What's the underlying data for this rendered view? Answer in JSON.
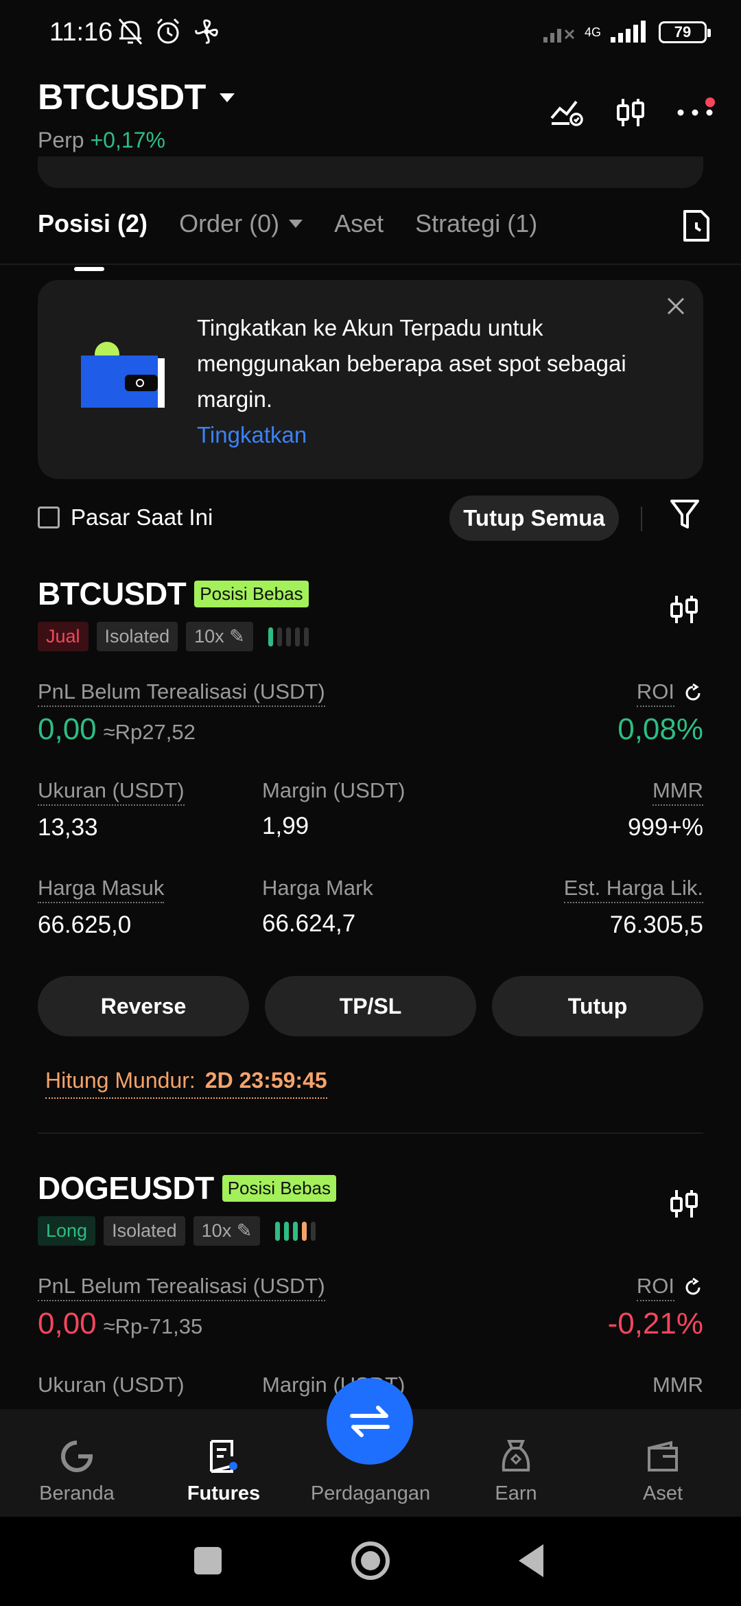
{
  "status_bar": {
    "time": "11:16",
    "network": "4G",
    "battery": "79"
  },
  "header": {
    "pair": "BTCUSDT",
    "type": "Perp",
    "change": "+0,17%"
  },
  "tabs": [
    {
      "label": "Posisi (2)"
    },
    {
      "label": "Order (0)"
    },
    {
      "label": "Aset"
    },
    {
      "label": "Strategi (1)"
    }
  ],
  "banner": {
    "text": "Tingkatkan ke Akun Terpadu untuk menggunakan beberapa aset spot sebagai margin.",
    "link": "Tingkatkan"
  },
  "filter": {
    "checkbox_label": "Pasar Saat Ini",
    "close_all": "Tutup Semua"
  },
  "positions": [
    {
      "pair": "BTCUSDT",
      "badge": "Posisi Bebas",
      "side": "Jual",
      "margin_mode": "Isolated",
      "leverage": "10x",
      "adl_level": 1,
      "pnl_label": "PnL Belum Terealisasi (USDT)",
      "pnl": "0,00",
      "pnl_idr": "≈Rp27,52",
      "roi_label": "ROI",
      "roi": "0,08%",
      "size_label": "Ukuran (USDT)",
      "size": "13,33",
      "margin_label": "Margin (USDT)",
      "margin": "1,99",
      "mmr_label": "MMR",
      "mmr": "999+%",
      "entry_label": "Harga Masuk",
      "entry": "66.625,0",
      "mark_label": "Harga Mark",
      "mark": "66.624,7",
      "liq_label": "Est. Harga Lik.",
      "liq": "76.305,5",
      "buttons": [
        "Reverse",
        "TP/SL",
        "Tutup"
      ],
      "countdown_label": "Hitung Mundur:",
      "countdown": "2D 23:59:45"
    },
    {
      "pair": "DOGEUSDT",
      "badge": "Posisi Bebas",
      "side": "Long",
      "margin_mode": "Isolated",
      "leverage": "10x",
      "adl_level": 4,
      "pnl_label": "PnL Belum Terealisasi (USDT)",
      "pnl": "0,00",
      "pnl_idr": "≈Rp-71,35",
      "roi_label": "ROI",
      "roi": "-0,21%",
      "size_label": "Ukuran (USDT)",
      "margin_label": "Margin (USDT)",
      "mmr_label": "MMR"
    }
  ],
  "bottom_nav": [
    {
      "label": "Beranda",
      "icon": "home-icon"
    },
    {
      "label": "Futures",
      "icon": "futures-icon"
    },
    {
      "label": "Perdagangan",
      "icon": "trade-icon"
    },
    {
      "label": "Earn",
      "icon": "earn-icon"
    },
    {
      "label": "Aset",
      "icon": "wallet-icon"
    }
  ],
  "colors": {
    "green": "#2ebd85",
    "red": "#f6465d",
    "orange": "#f5a36b",
    "blue": "#1f6fff",
    "badge": "#a3f05a"
  }
}
